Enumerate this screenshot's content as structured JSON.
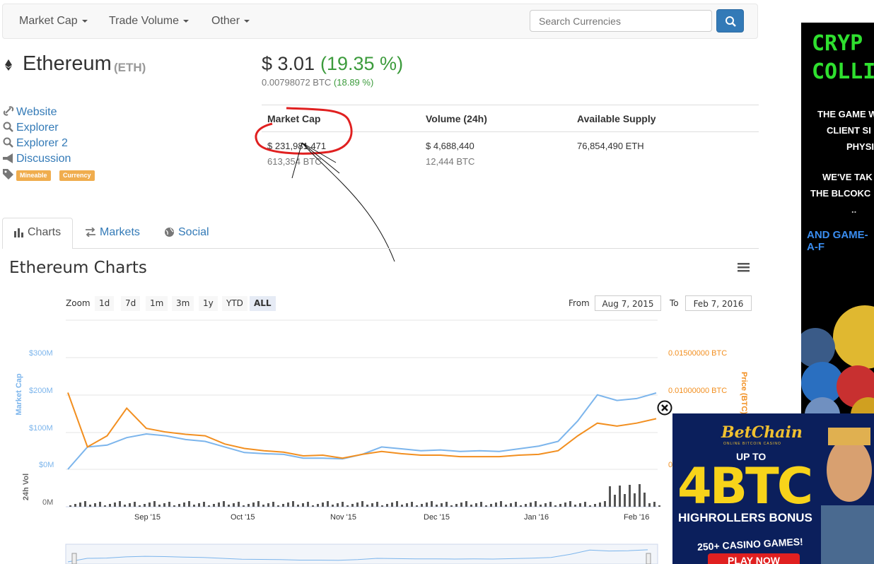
{
  "nav": {
    "items": [
      "Market Cap",
      "Trade Volume",
      "Other"
    ],
    "search_placeholder": "Search Currencies"
  },
  "coin": {
    "name": "Ethereum",
    "symbol": "(ETH)",
    "price_usd": "$ 3.01",
    "change_usd": "(19.35 %)",
    "price_btc": "0.00798072 BTC",
    "change_btc": "(18.89 %)"
  },
  "links": [
    "Website",
    "Explorer",
    "Explorer 2",
    "Discussion"
  ],
  "tags": [
    "Mineable",
    "Currency"
  ],
  "stats": {
    "headers": [
      "Market Cap",
      "Volume (24h)",
      "Available Supply"
    ],
    "market_cap_usd": "$ 231,981,471",
    "market_cap_btc": "613,354 BTC",
    "volume_usd": "$ 4,688,440",
    "volume_btc": "12,444 BTC",
    "supply": "76,854,490 ETH"
  },
  "tabs": [
    "Charts",
    "Markets",
    "Social"
  ],
  "chart": {
    "title": "Ethereum Charts",
    "zoom_label": "Zoom",
    "zoom_buttons": [
      "1d",
      "7d",
      "1m",
      "3m",
      "1y",
      "YTD",
      "ALL"
    ],
    "selected_zoom": "ALL",
    "from_label": "From",
    "to_label": "To",
    "from_date": "Aug 7, 2015",
    "to_date": "Feb 7, 2016"
  },
  "chart_data": {
    "type": "line",
    "title": "Ethereum Charts",
    "left_axis_label": "Market Cap",
    "right_axis_label": "Price (BTC)",
    "volume_axis_label": "24h Vol",
    "left_ticks": [
      "$300M",
      "$200M",
      "$100M",
      "$0M"
    ],
    "right_ticks": [
      "0.01500000 BTC",
      "0.01000000 BTC",
      "0"
    ],
    "volume_ticks": [
      "0M"
    ],
    "x_ticks": [
      "Sep '15",
      "Oct '15",
      "Nov '15",
      "Dec '15",
      "Jan '16",
      "Feb '16"
    ],
    "left_ylim": [
      0,
      300
    ],
    "right_ylim": [
      0,
      0.015
    ],
    "series": [
      {
        "name": "Market Cap",
        "unit": "$M",
        "color": "#7cb5ec",
        "values": [
          0,
          60,
          65,
          85,
          95,
          90,
          80,
          75,
          60,
          45,
          42,
          40,
          30,
          30,
          28,
          40,
          60,
          55,
          50,
          52,
          48,
          50,
          48,
          55,
          62,
          75,
          130,
          200,
          185,
          190,
          205
        ]
      },
      {
        "name": "Price (BTC)",
        "color": "#f28f20",
        "values": [
          0.0103,
          0.003,
          0.0045,
          0.0082,
          0.0055,
          0.005,
          0.0047,
          0.0045,
          0.0034,
          0.0028,
          0.0025,
          0.0023,
          0.0018,
          0.0019,
          0.0015,
          0.002,
          0.0024,
          0.0021,
          0.0019,
          0.0019,
          0.0017,
          0.0017,
          0.0017,
          0.0019,
          0.002,
          0.0025,
          0.0045,
          0.0062,
          0.0058,
          0.0062,
          0.0068
        ]
      }
    ]
  },
  "ads": {
    "crypto_lines": [
      "CRYP",
      "COLLID"
    ],
    "crypto_text": [
      "THE GAME W",
      "CLIENT SI",
      "PHYSICS",
      "WE'VE TAK",
      "THE BLCOKC",
      "..",
      "AND GAME-A-F"
    ],
    "bet_brand": "BetChain",
    "bet_sub": "ONLINE BITCOIN CASINO",
    "bet_upto": "UP TO",
    "bet_amount": "4BTC",
    "bet_bonus": "HIGHROLLERS BONUS",
    "bet_games": "250+ CASINO GAMES!",
    "bet_play": "PLAY NOW"
  }
}
